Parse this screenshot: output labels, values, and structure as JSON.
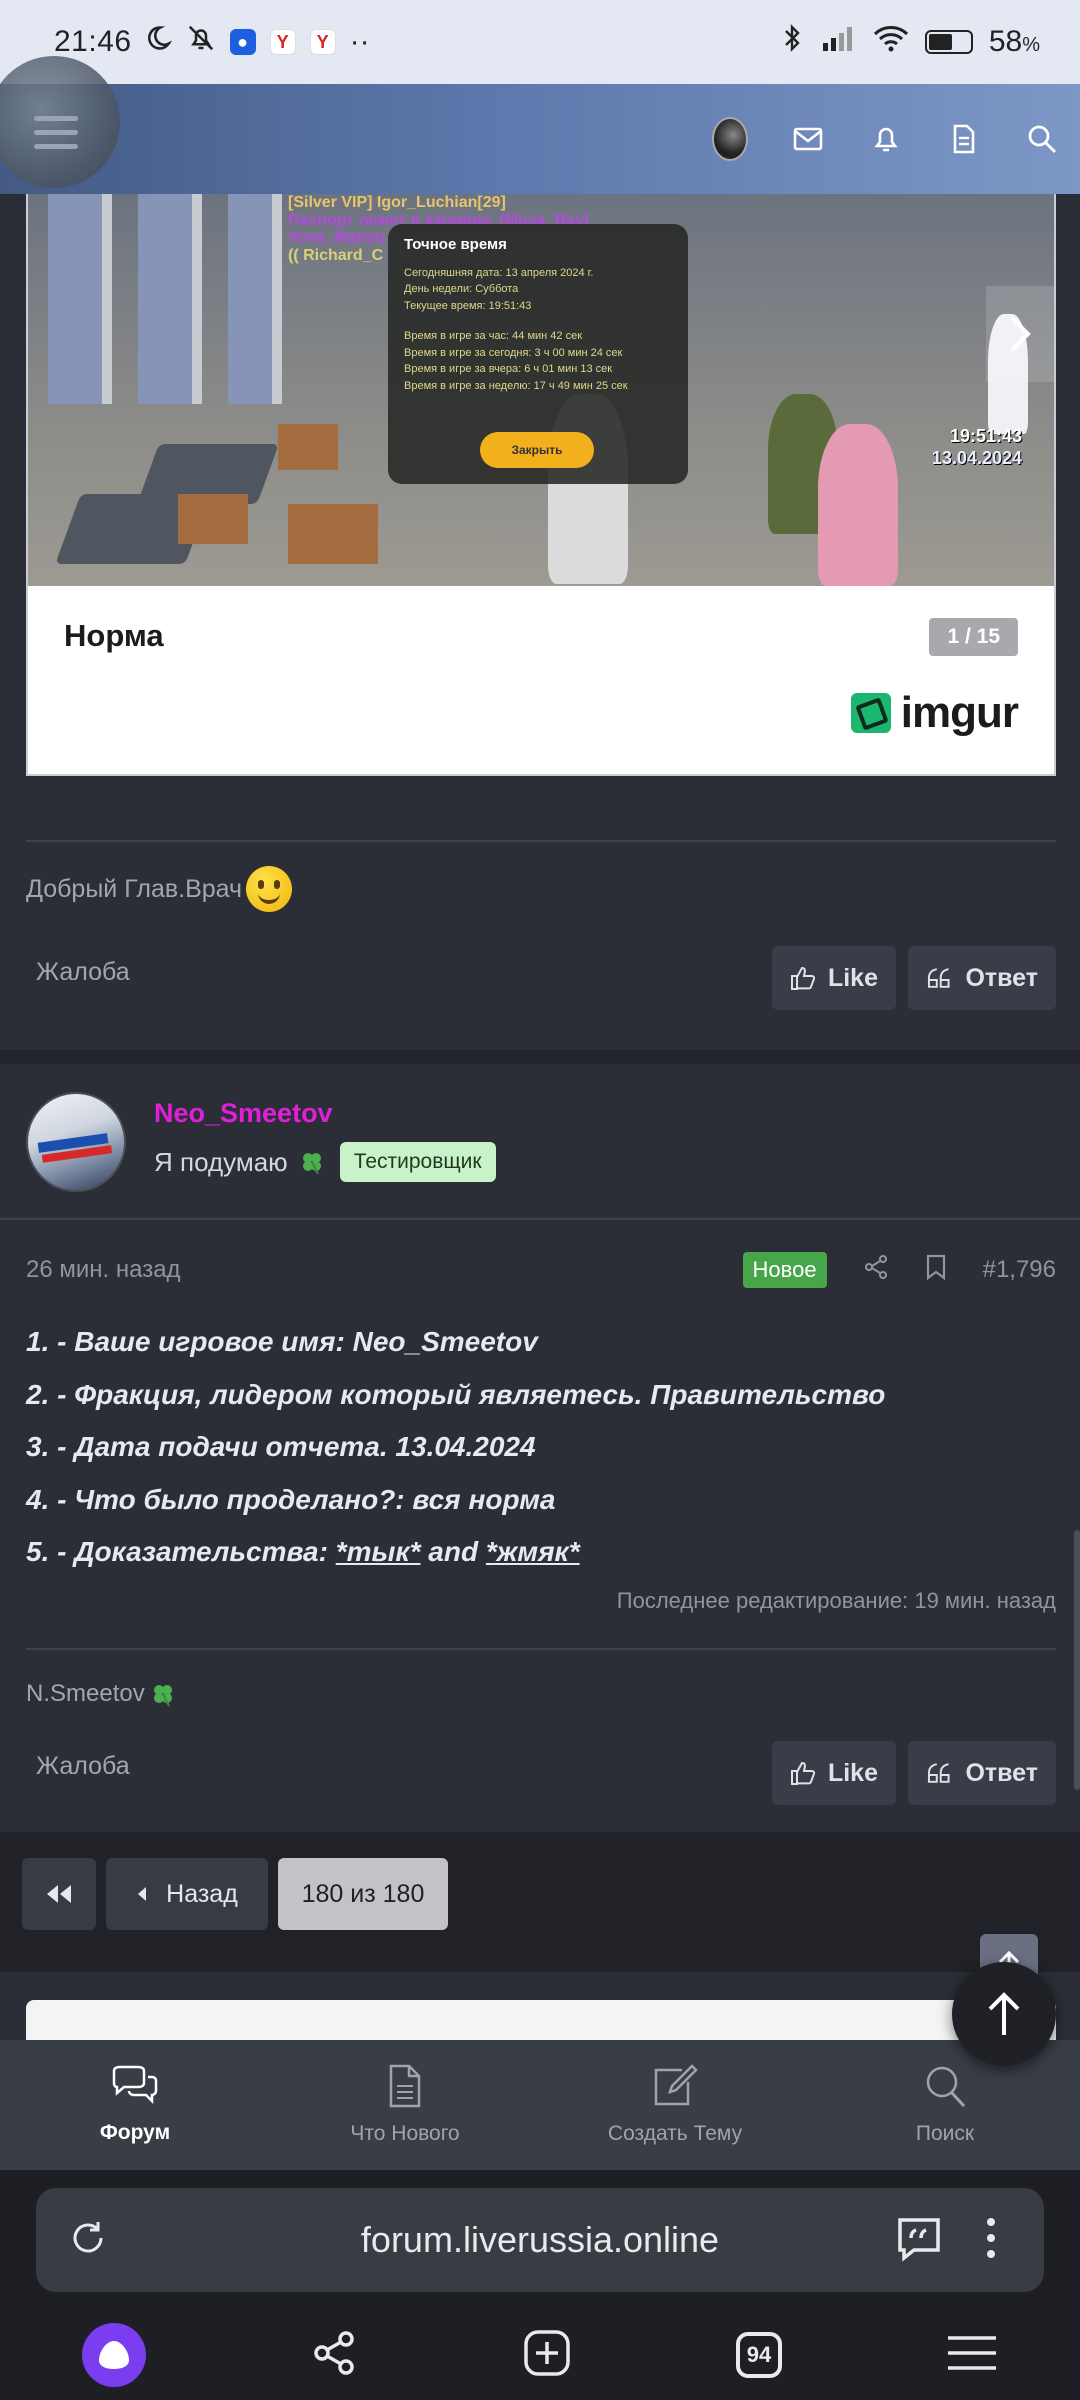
{
  "status_bar": {
    "time": "21:46",
    "battery_text": "58",
    "battery_unit": "%",
    "battery_level": 0.58,
    "dots": "··"
  },
  "embed": {
    "caption": "Норма",
    "pager": "1 / 15",
    "brand": "imgur",
    "screenshot": {
      "chat_lines": [
        "[Silver VIP] Igor_Luchian[29]",
        "Паспорт лежит в кармане. (Musa_Bay)",
        "Vova_Mahou",
        "(( Richard_C"
      ],
      "panel_title": "Точное время",
      "panel_lines": [
        "Сегодняшняя дата: 13 апреля 2024 г.",
        "День недели: Суббота",
        "Текущее время: 19:51:43",
        "",
        "Время в игре за час: 44 мин 42 сек",
        "Время в игре за сегодня: 3 ч 00 мин 24 сек",
        "Время в игре за вчера: 6 ч 01 мин 13 сек",
        "Время в игре за неделю: 17 ч 49 мин 25 сек"
      ],
      "panel_button": "Закрыть",
      "hud_time": "19:51:43",
      "hud_date": "13.04.2024"
    }
  },
  "post1": {
    "signature": "Добрый Глав.Врач",
    "report": "Жалоба",
    "like": "Like",
    "reply": "Ответ"
  },
  "post2": {
    "author": "Neo_Smeetov",
    "user_title": "Я подумаю",
    "badge": "Тестировщик",
    "time": "26 мин. назад",
    "new_badge": "Новое",
    "number": "#1,796",
    "lines": {
      "l1": "1. - Ваше игровое имя: Neo_Smeetov",
      "l2": "2. - Фракция, лидером который являетесь. Правительство",
      "l3": "3. - Дата подачи отчета. 13.04.2024",
      "l4": "4. - Что было проделано?: вся норма",
      "l5_prefix": "5. - Доказательства: ",
      "l5_link1": "*тык*",
      "l5_mid": " and ",
      "l5_link2": "*жмяк*"
    },
    "last_edit": "Последнее редактирование: 19 мин. назад",
    "signature": "N.Smeetov",
    "report": "Жалоба",
    "like": "Like",
    "reply": "Ответ"
  },
  "pagination": {
    "back": "Назад",
    "current": "180 из 180"
  },
  "tabs": [
    {
      "label": "Форум",
      "icon": "chat-bubbles-icon",
      "active": true
    },
    {
      "label": "Что Нового",
      "icon": "document-icon",
      "active": false
    },
    {
      "label": "Создать Тему",
      "icon": "edit-icon",
      "active": false
    },
    {
      "label": "Поиск",
      "icon": "search-icon",
      "active": false
    }
  ],
  "browser": {
    "url": "forum.liverussia.online",
    "tab_count": "94"
  },
  "colors": {
    "header_gradient_start": "#445a85",
    "header_gradient_end": "#7d97c6",
    "author_name": "#e01fd9",
    "new_badge": "#47a54a",
    "tester_badge": "#c8f2c8"
  }
}
